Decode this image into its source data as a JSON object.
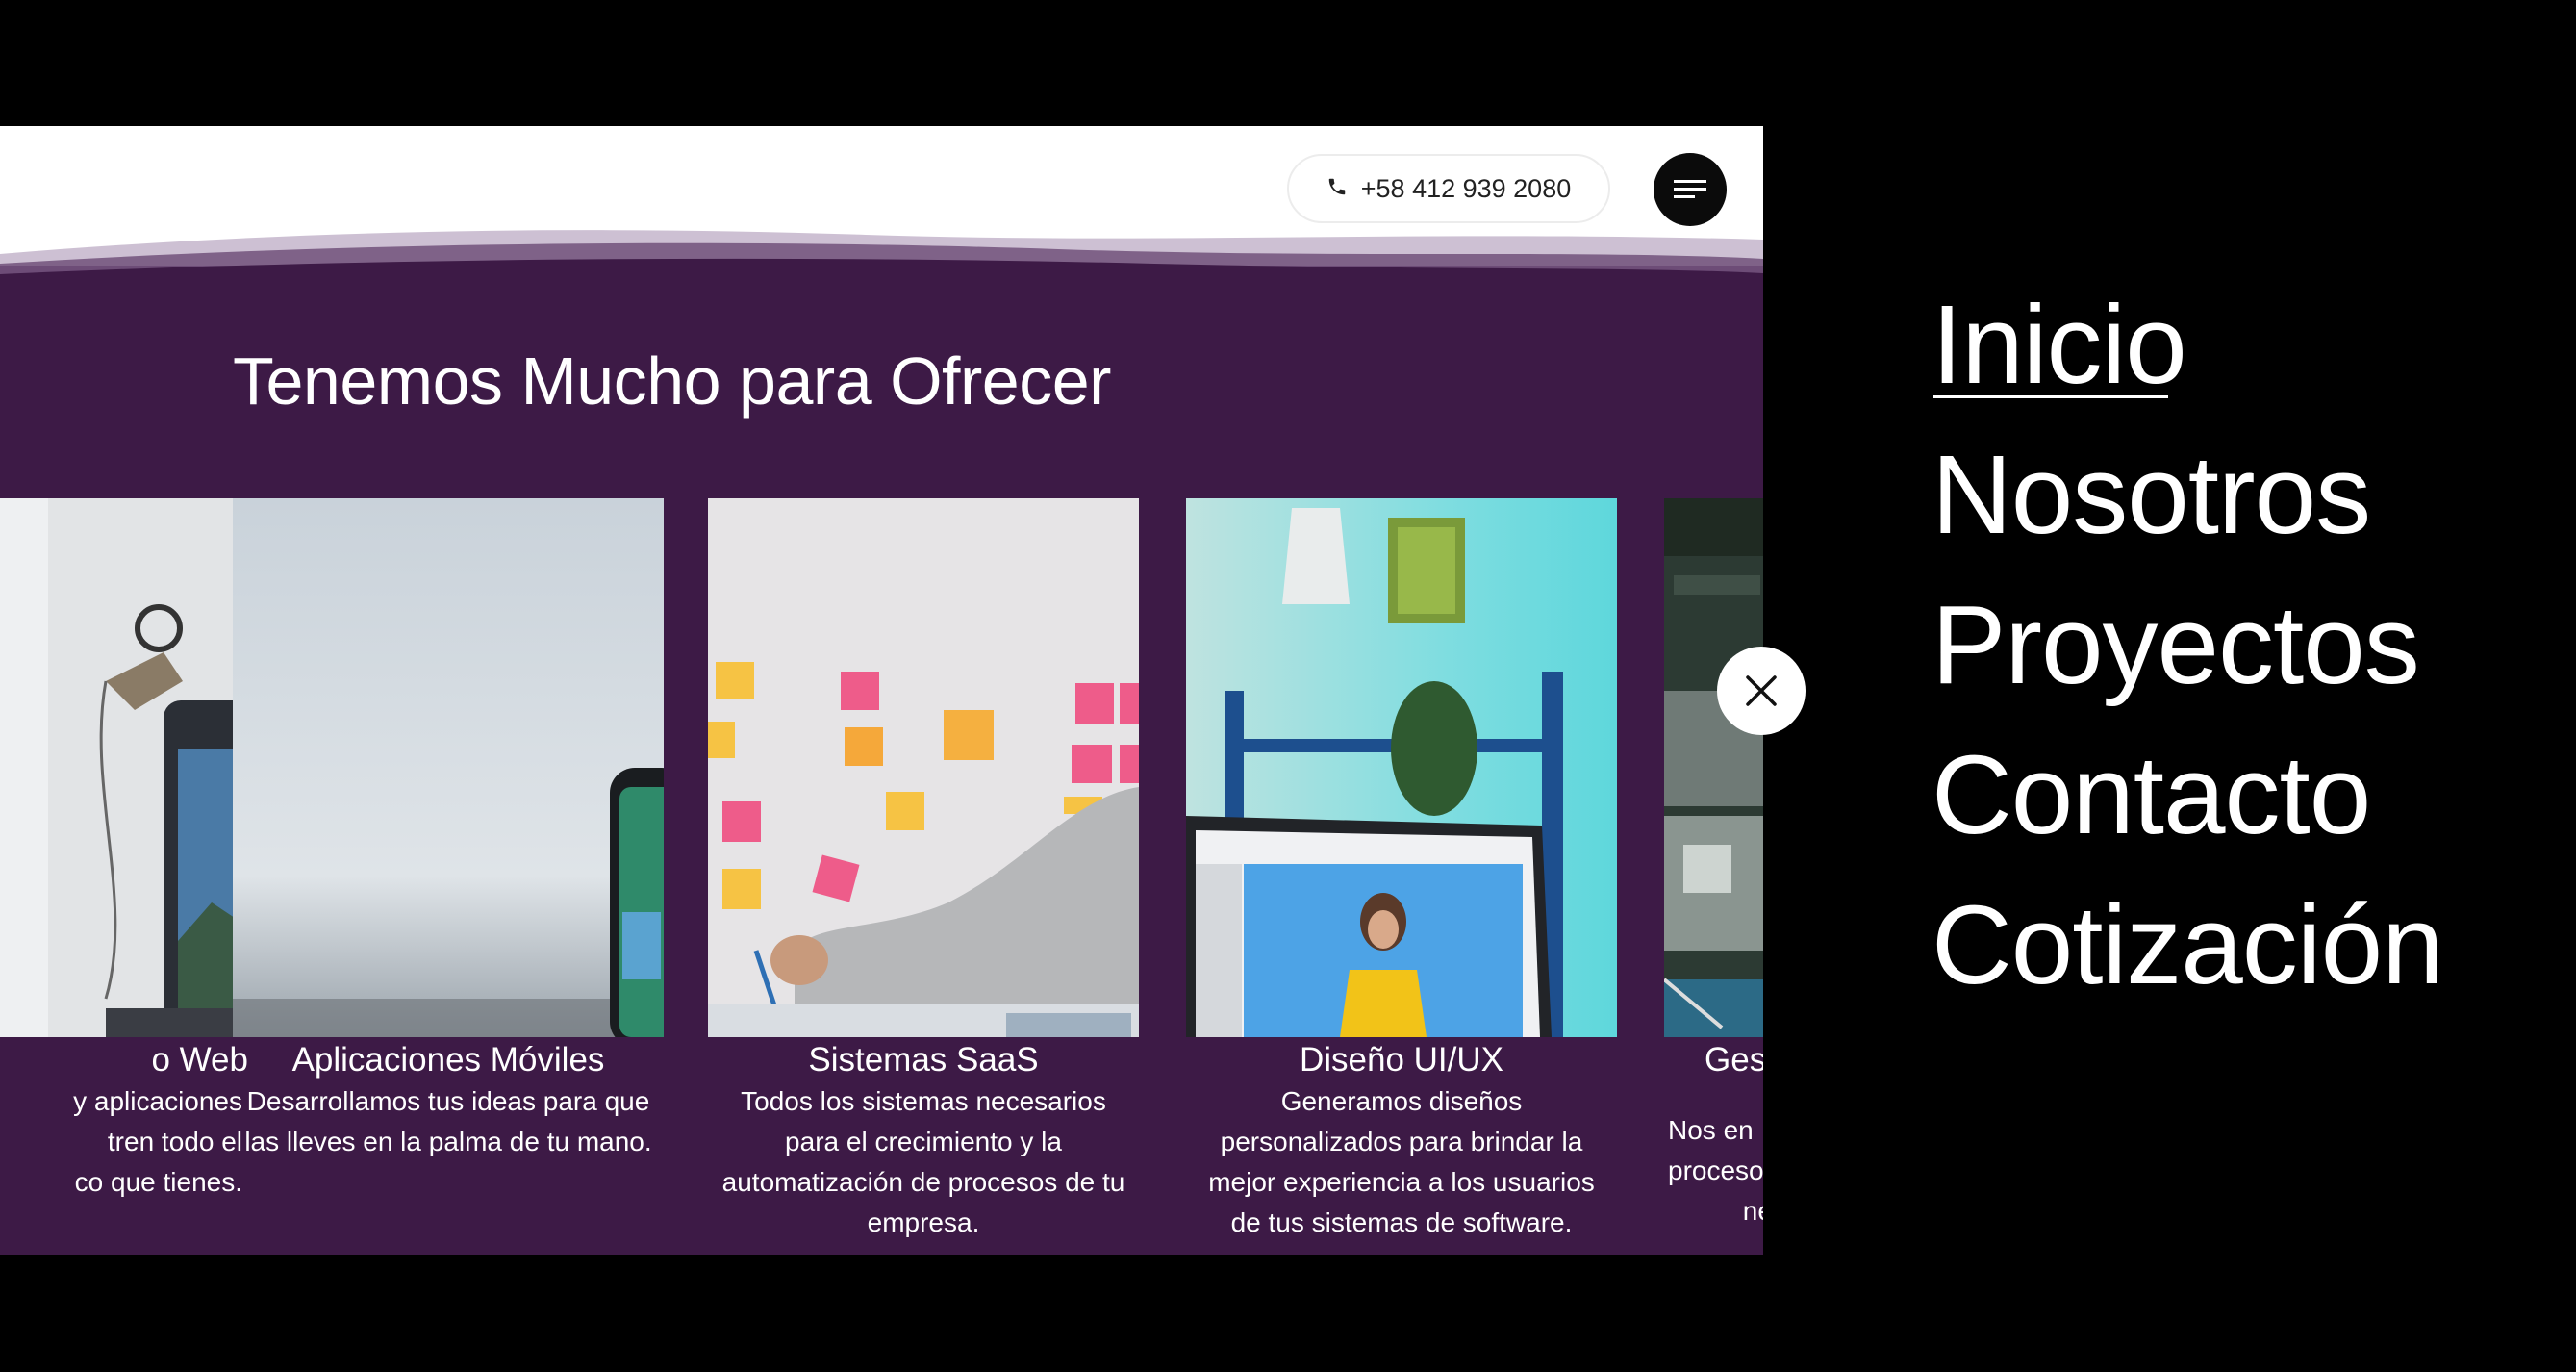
{
  "header": {
    "phone": "+58 412 939 2080",
    "phone_icon": "phone-icon",
    "menu_icon": "hamburger-menu-icon"
  },
  "section": {
    "title": "Tenemos Mucho para Ofrecer"
  },
  "services": [
    {
      "title": "o Web",
      "desc": "y aplicaciones\ntren todo el\nco que tienes."
    },
    {
      "title": "Aplicaciones Móviles",
      "desc": "Desarrollamos tus ideas para que las lleves en la palma de tu mano."
    },
    {
      "title": "Sistemas SaaS",
      "desc": "Todos los sistemas necesarios para el crecimiento y la automatización de procesos de tu empresa."
    },
    {
      "title": "Diseño UI/UX",
      "desc": "Generamos diseños personalizados para brindar la mejor experiencia a los usuarios de tus sistemas de software."
    },
    {
      "title": "Ges",
      "desc": "Nos en\nproceso\nne"
    }
  ],
  "overlay_menu": {
    "close_icon": "close-icon",
    "items": [
      "Inicio",
      "Nosotros",
      "Proyectos",
      "Contacto",
      "Cotización"
    ],
    "active": "Inicio"
  },
  "colors": {
    "brand_purple": "#3d1a46",
    "overlay": "#000000"
  }
}
